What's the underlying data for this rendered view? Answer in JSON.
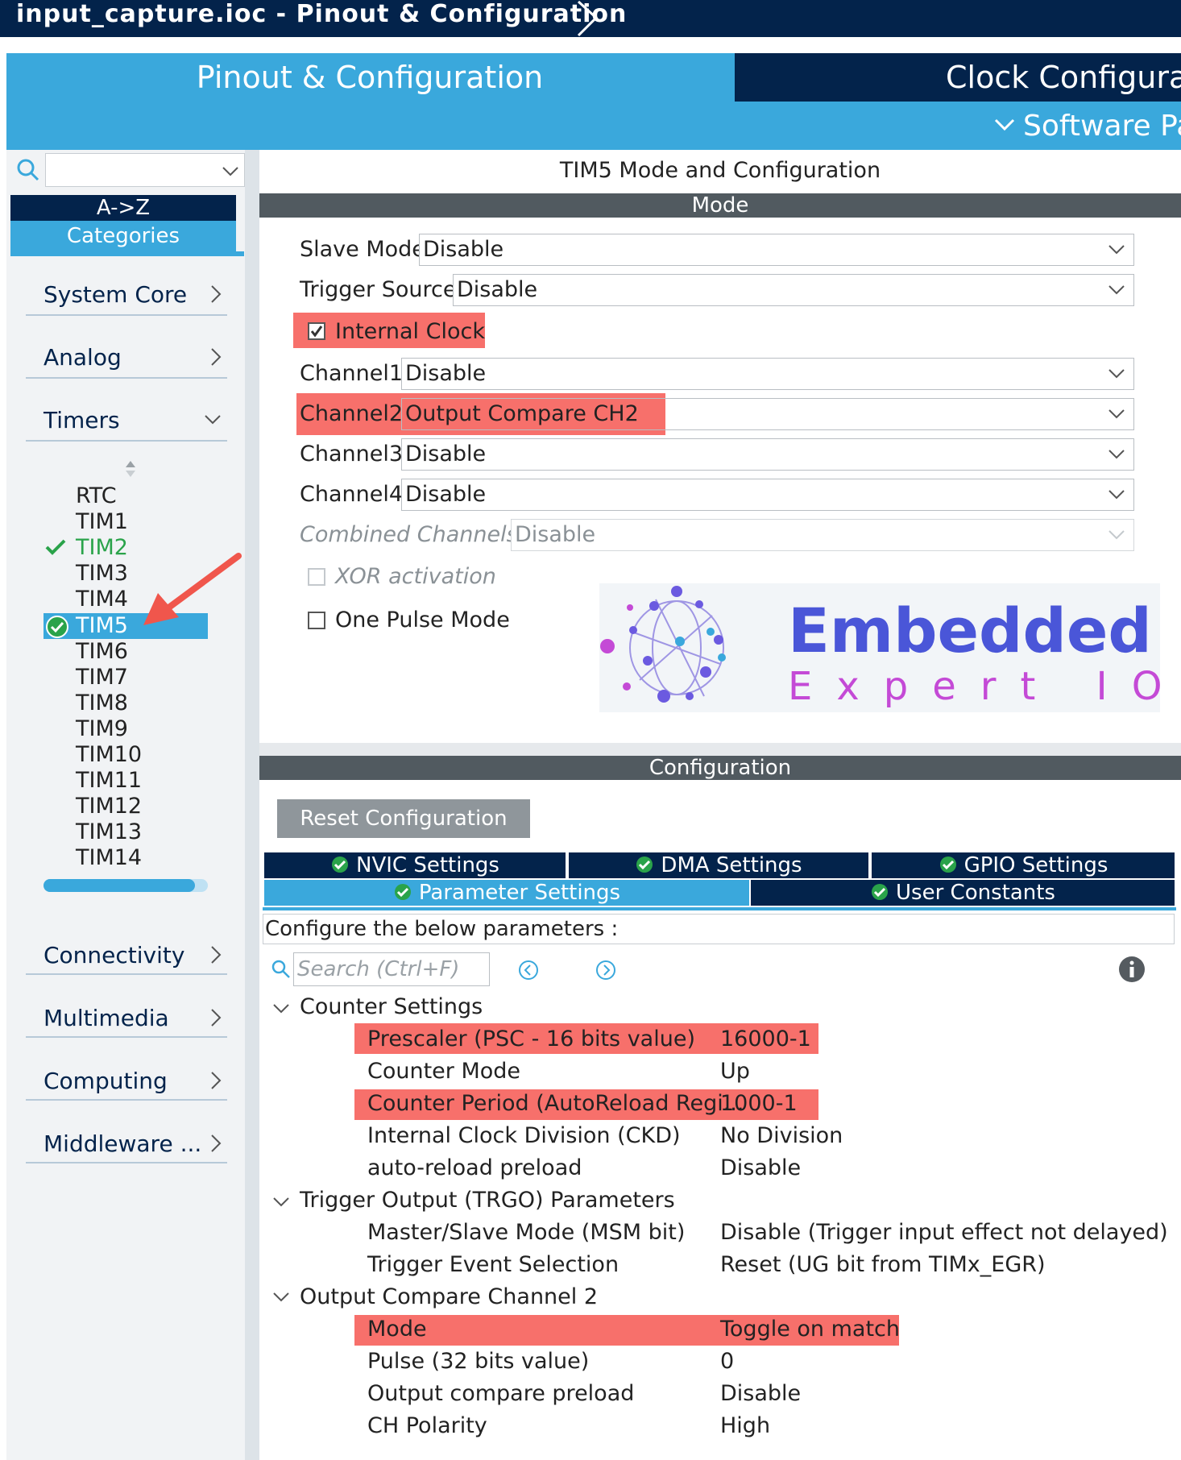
{
  "window": {
    "title": "input_capture.ioc - Pinout & Configuration"
  },
  "tabs": {
    "pinout": "Pinout & Configuration",
    "clock": "Clock Configura",
    "software_packs": "Software Pac"
  },
  "left": {
    "sort_az": "A->Z",
    "sort_categories": "Categories",
    "categories": {
      "system_core": "System Core",
      "analog": "Analog",
      "timers": "Timers",
      "connectivity": "Connectivity",
      "multimedia": "Multimedia",
      "computing": "Computing",
      "middleware": "Middleware ..."
    },
    "timers": [
      "RTC",
      "TIM1",
      "TIM2",
      "TIM3",
      "TIM4",
      "TIM5",
      "TIM6",
      "TIM7",
      "TIM8",
      "TIM9",
      "TIM10",
      "TIM11",
      "TIM12",
      "TIM13",
      "TIM14"
    ],
    "configured_color": "#2aa34a",
    "selected_color": "#3aa8dc"
  },
  "mode": {
    "title": "TIM5 Mode and Configuration",
    "header": "Mode",
    "slave_mode": {
      "label": "Slave Mode",
      "value": "Disable"
    },
    "trigger_source": {
      "label": "Trigger Source",
      "value": "Disable"
    },
    "internal_clock": {
      "label": "Internal Clock",
      "checked": true
    },
    "channel1": {
      "label": "Channel1",
      "value": "Disable"
    },
    "channel2": {
      "label": "Channel2",
      "value": "Output Compare CH2"
    },
    "channel3": {
      "label": "Channel3",
      "value": "Disable"
    },
    "channel4": {
      "label": "Channel4",
      "value": "Disable"
    },
    "combined_channels": {
      "label": "Combined Channels",
      "value": "Disable"
    },
    "xor_activation": {
      "label": "XOR activation",
      "checked": false
    },
    "one_pulse_mode": {
      "label": "One Pulse Mode",
      "checked": false
    },
    "highlight_color": "#f7706b"
  },
  "logo": {
    "line1": "Embedded",
    "line2": "Expert IO"
  },
  "configuration": {
    "header": "Configuration",
    "reset_button": "Reset Configuration",
    "tabs": {
      "nvic": "NVIC Settings",
      "dma": "DMA Settings",
      "gpio": "GPIO Settings",
      "parameter": "Parameter Settings",
      "user_constants": "User Constants"
    },
    "description": "Configure the below parameters :",
    "search_placeholder": "Search (Ctrl+F)",
    "groups": {
      "counter": {
        "title": "Counter Settings",
        "rows": [
          {
            "name": "Prescaler (PSC - 16 bits value)",
            "value": "16000-1"
          },
          {
            "name": "Counter Mode",
            "value": "Up"
          },
          {
            "name": "Counter Period (AutoReload Regi...",
            "value": "1000-1"
          },
          {
            "name": "Internal Clock Division (CKD)",
            "value": "No Division"
          },
          {
            "name": "auto-reload preload",
            "value": "Disable"
          }
        ]
      },
      "trgo": {
        "title": "Trigger Output (TRGO) Parameters",
        "rows": [
          {
            "name": "Master/Slave Mode (MSM bit)",
            "value": "Disable (Trigger input effect not delayed)"
          },
          {
            "name": "Trigger Event Selection",
            "value": "Reset (UG bit from TIMx_EGR)"
          }
        ]
      },
      "oc2": {
        "title": "Output Compare Channel 2",
        "rows": [
          {
            "name": "Mode",
            "value": "Toggle on match"
          },
          {
            "name": "Pulse (32 bits value)",
            "value": "0"
          },
          {
            "name": "Output compare preload",
            "value": "Disable"
          },
          {
            "name": "CH Polarity",
            "value": "High"
          }
        ]
      }
    }
  }
}
